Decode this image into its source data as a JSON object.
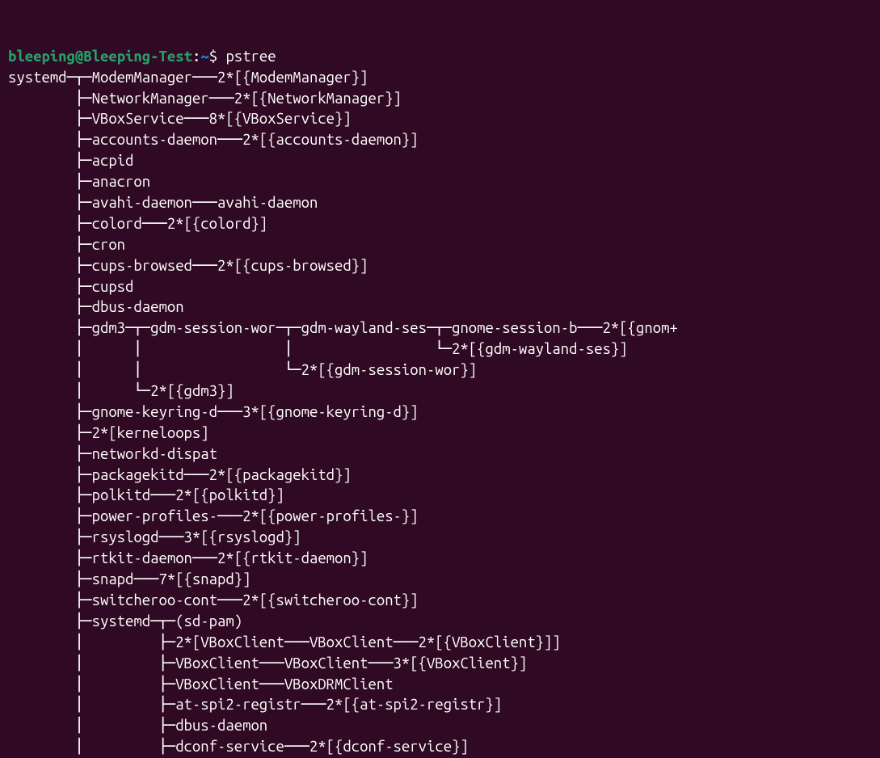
{
  "prompt": {
    "user": "bleeping",
    "at": "@",
    "host": "Bleeping-Test",
    "colon": ":",
    "path": "~",
    "sep": "$ ",
    "cmd": "pstree"
  },
  "lines": {
    "l00": "systemd─┬─ModemManager───2*[{ModemManager}]",
    "l01": "        ├─NetworkManager───2*[{NetworkManager}]",
    "l02": "        ├─VBoxService───8*[{VBoxService}]",
    "l03": "        ├─accounts-daemon───2*[{accounts-daemon}]",
    "l04": "        ├─acpid",
    "l05": "        ├─anacron",
    "l06": "        ├─avahi-daemon───avahi-daemon",
    "l07": "        ├─colord───2*[{colord}]",
    "l08": "        ├─cron",
    "l09": "        ├─cups-browsed───2*[{cups-browsed}]",
    "l10": "        ├─cupsd",
    "l11": "        ├─dbus-daemon",
    "l12": "        ├─gdm3─┬─gdm-session-wor─┬─gdm-wayland-ses─┬─gnome-session-b───2*[{gnom+",
    "l13": "        │      │                 │                 └─2*[{gdm-wayland-ses}]",
    "l14": "        │      │                 └─2*[{gdm-session-wor}]",
    "l15": "        │      └─2*[{gdm3}]",
    "l16": "        ├─gnome-keyring-d───3*[{gnome-keyring-d}]",
    "l17": "        ├─2*[kerneloops]",
    "l18": "        ├─networkd-dispat",
    "l19": "        ├─packagekitd───2*[{packagekitd}]",
    "l20": "        ├─polkitd───2*[{polkitd}]",
    "l21": "        ├─power-profiles-───2*[{power-profiles-}]",
    "l22": "        ├─rsyslogd───3*[{rsyslogd}]",
    "l23": "        ├─rtkit-daemon───2*[{rtkit-daemon}]",
    "l24": "        ├─snapd───7*[{snapd}]",
    "l25": "        ├─switcheroo-cont───2*[{switcheroo-cont}]",
    "l26": "        ├─systemd─┬─(sd-pam)",
    "l27": "        │         ├─2*[VBoxClient───VBoxClient───2*[{VBoxClient}]]",
    "l28": "        │         ├─VBoxClient───VBoxClient───3*[{VBoxClient}]",
    "l29": "        │         ├─VBoxClient───VBoxDRMClient",
    "l30": "        │         ├─at-spi2-registr───2*[{at-spi2-registr}]",
    "l31": "        │         ├─dbus-daemon",
    "l32": "        │         ├─dconf-service───2*[{dconf-service}]"
  }
}
